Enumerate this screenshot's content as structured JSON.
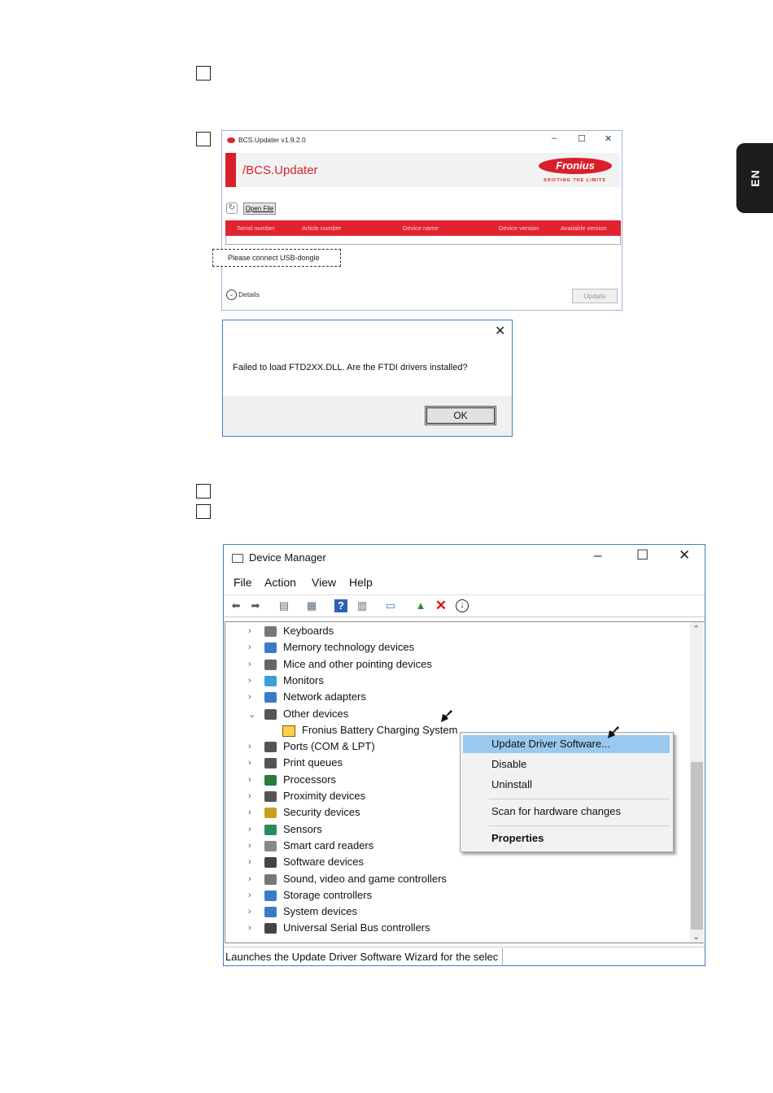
{
  "lang_tab": "EN",
  "bcs": {
    "title": "BCS.Updater v1.9.2.0",
    "header": "/BCS.Updater",
    "logo": "Fronius",
    "logo_tagline": "SHIFTING THE LIMITS",
    "open_file": "Open File",
    "columns": [
      "Serial number",
      "Article number",
      "Device name",
      "Device version",
      "Available version"
    ],
    "dongle_msg": "Please connect USB-dongle",
    "details": "Details",
    "update": "Update"
  },
  "dialog": {
    "message": "Failed to load FTD2XX.DLL.  Are the FTDI drivers installed?",
    "ok": "OK"
  },
  "device_manager": {
    "title": "Device Manager",
    "menu": [
      "File",
      "Action",
      "View",
      "Help"
    ],
    "tree": [
      {
        "label": "Keyboards",
        "expanded": false,
        "icon": "keyboard-icon"
      },
      {
        "label": "Memory technology devices",
        "expanded": false,
        "icon": "memory-icon"
      },
      {
        "label": "Mice and other pointing devices",
        "expanded": false,
        "icon": "mouse-icon"
      },
      {
        "label": "Monitors",
        "expanded": false,
        "icon": "monitor-icon"
      },
      {
        "label": "Network adapters",
        "expanded": false,
        "icon": "network-icon"
      },
      {
        "label": "Other devices",
        "expanded": true,
        "icon": "unknown-device-icon"
      },
      {
        "label": "Fronius Battery Charging System",
        "child": true,
        "icon": "warning-device-icon"
      },
      {
        "label": "Ports (COM & LPT)",
        "expanded": false,
        "icon": "port-icon"
      },
      {
        "label": "Print queues",
        "expanded": false,
        "icon": "printer-icon"
      },
      {
        "label": "Processors",
        "expanded": false,
        "icon": "cpu-icon"
      },
      {
        "label": "Proximity devices",
        "expanded": false,
        "icon": "proximity-icon"
      },
      {
        "label": "Security devices",
        "expanded": false,
        "icon": "security-icon"
      },
      {
        "label": "Sensors",
        "expanded": false,
        "icon": "sensor-icon"
      },
      {
        "label": "Smart card readers",
        "expanded": false,
        "icon": "smartcard-icon"
      },
      {
        "label": "Software devices",
        "expanded": false,
        "icon": "software-icon"
      },
      {
        "label": "Sound, video and game controllers",
        "expanded": false,
        "icon": "sound-icon"
      },
      {
        "label": "Storage controllers",
        "expanded": false,
        "icon": "storage-icon"
      },
      {
        "label": "System devices",
        "expanded": false,
        "icon": "system-icon"
      },
      {
        "label": "Universal Serial Bus controllers",
        "expanded": false,
        "icon": "usb-icon"
      }
    ],
    "context_menu": [
      "Update Driver Software...",
      "Disable",
      "Uninstall",
      "Scan for hardware changes",
      "Properties"
    ],
    "status": "Launches the Update Driver Software Wizard for the selec"
  },
  "colors": {
    "accent": "#d8202b",
    "selection": "#99c9ef"
  }
}
